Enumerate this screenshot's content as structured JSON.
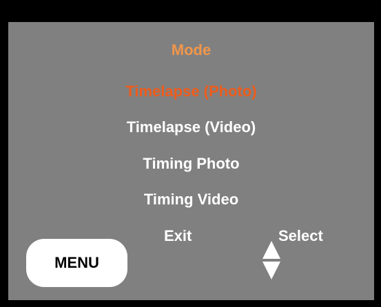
{
  "screen": {
    "title": "Mode",
    "items": [
      {
        "label": "Timelapse (Photo)",
        "selected": true
      },
      {
        "label": "Timelapse (Video)",
        "selected": false
      },
      {
        "label": "Timing Photo",
        "selected": false
      },
      {
        "label": "Timing Video",
        "selected": false
      }
    ],
    "exit_label": "Exit",
    "select_label": "Select",
    "menu_button_label": "MENU",
    "updown_icon": "up-down-arrows-icon"
  },
  "colors": {
    "bezel": "#000000",
    "screen_background": "#808080",
    "title": "#f0964b",
    "selected_item": "#ef5c1c",
    "item": "#ffffff",
    "button": "#ffffff"
  }
}
